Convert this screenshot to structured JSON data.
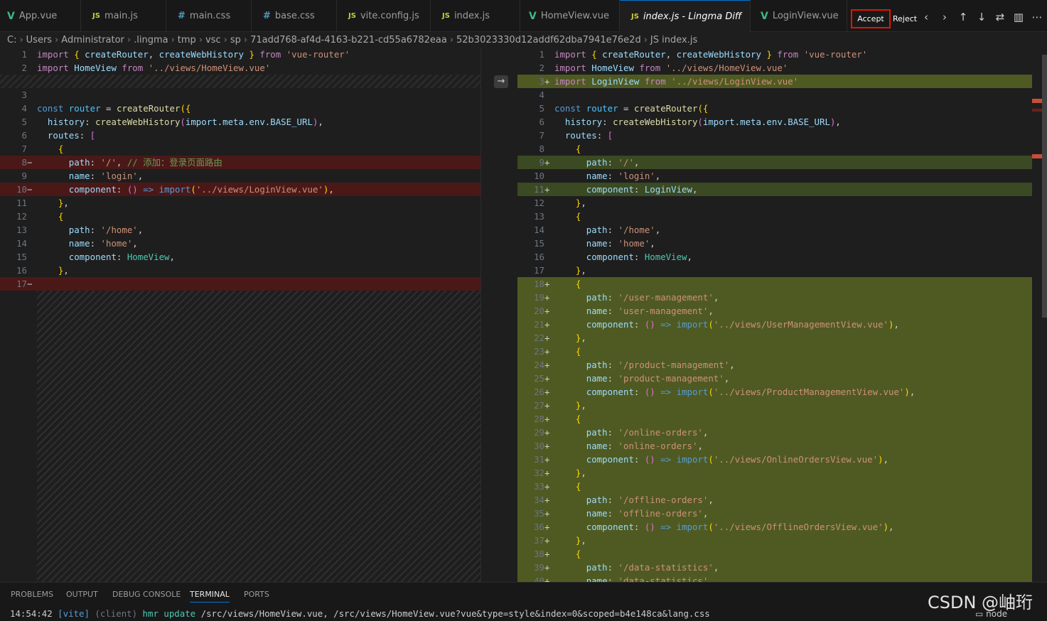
{
  "tabs": [
    {
      "label": "App.vue",
      "icon": "vue"
    },
    {
      "label": "main.js",
      "icon": "js"
    },
    {
      "label": "main.css",
      "icon": "css"
    },
    {
      "label": "base.css",
      "icon": "css"
    },
    {
      "label": "vite.config.js",
      "icon": "js"
    },
    {
      "label": "index.js",
      "icon": "js"
    },
    {
      "label": "HomeView.vue",
      "icon": "vue"
    },
    {
      "label": "index.js - Lingma Diff",
      "icon": "js",
      "active": true
    },
    {
      "label": "LoginView.vue",
      "icon": "vue"
    }
  ],
  "toolbar": {
    "accept": "Accept",
    "reject": "Reject"
  },
  "breadcrumb": [
    "C:",
    "Users",
    "Administrator",
    ".lingma",
    "tmp",
    "vsc",
    "sp",
    "71add768-af4d-4163-b221-cd55a6782eaa",
    "52b3023330d12addf62dba7941e76e2d",
    "index.js"
  ],
  "left_lines": [
    {
      "n": "1",
      "m": "",
      "t": "import_start"
    },
    {
      "n": "2",
      "m": "",
      "t": "import_home"
    },
    {
      "n": "",
      "m": "",
      "t": "hatch"
    },
    {
      "n": "3",
      "m": "",
      "t": "blank"
    },
    {
      "n": "4",
      "m": "",
      "t": "const_router"
    },
    {
      "n": "5",
      "m": "",
      "t": "history"
    },
    {
      "n": "6",
      "m": "",
      "t": "routes"
    },
    {
      "n": "7",
      "m": "",
      "t": "obj_open"
    },
    {
      "n": "8",
      "m": "−",
      "t": "path_root_comment",
      "cls": "del"
    },
    {
      "n": "9",
      "m": "",
      "t": "name_login"
    },
    {
      "n": "10",
      "m": "−",
      "t": "component_login_import",
      "cls": "del"
    },
    {
      "n": "11",
      "m": "",
      "t": "obj_close"
    },
    {
      "n": "12",
      "m": "",
      "t": "obj_open"
    },
    {
      "n": "13",
      "m": "",
      "t": "path_home"
    },
    {
      "n": "14",
      "m": "",
      "t": "name_home"
    },
    {
      "n": "15",
      "m": "",
      "t": "component_home"
    },
    {
      "n": "16",
      "m": "",
      "t": "obj_close"
    },
    {
      "n": "17",
      "m": "−",
      "t": "blank",
      "cls": "del"
    }
  ],
  "right_lines": [
    {
      "n": "1",
      "m": "",
      "t": "import_start"
    },
    {
      "n": "2",
      "m": "",
      "t": "import_home"
    },
    {
      "n": "3",
      "m": "+",
      "t": "import_login",
      "cls": "addfull"
    },
    {
      "n": "4",
      "m": "",
      "t": "blank"
    },
    {
      "n": "5",
      "m": "",
      "t": "const_router"
    },
    {
      "n": "6",
      "m": "",
      "t": "history"
    },
    {
      "n": "7",
      "m": "",
      "t": "routes"
    },
    {
      "n": "8",
      "m": "",
      "t": "obj_open"
    },
    {
      "n": "9",
      "m": "+",
      "t": "path_root",
      "cls": "add"
    },
    {
      "n": "10",
      "m": "",
      "t": "name_login"
    },
    {
      "n": "11",
      "m": "+",
      "t": "component_login",
      "cls": "add"
    },
    {
      "n": "12",
      "m": "",
      "t": "obj_close"
    },
    {
      "n": "13",
      "m": "",
      "t": "obj_open"
    },
    {
      "n": "14",
      "m": "",
      "t": "path_home"
    },
    {
      "n": "15",
      "m": "",
      "t": "name_home"
    },
    {
      "n": "16",
      "m": "",
      "t": "component_home"
    },
    {
      "n": "17",
      "m": "",
      "t": "obj_close"
    },
    {
      "n": "18",
      "m": "+",
      "t": "obj_open",
      "cls": "addfull"
    },
    {
      "n": "19",
      "m": "+",
      "t": "path:'/user-management'",
      "cls": "addfull"
    },
    {
      "n": "20",
      "m": "+",
      "t": "name:'user-management'",
      "cls": "addfull"
    },
    {
      "n": "21",
      "m": "+",
      "t": "comp:'../views/UserManagementView.vue'",
      "cls": "addfull"
    },
    {
      "n": "22",
      "m": "+",
      "t": "obj_close",
      "cls": "addfull"
    },
    {
      "n": "23",
      "m": "+",
      "t": "obj_open",
      "cls": "addfull"
    },
    {
      "n": "24",
      "m": "+",
      "t": "path:'/product-management'",
      "cls": "addfull"
    },
    {
      "n": "25",
      "m": "+",
      "t": "name:'product-management'",
      "cls": "addfull"
    },
    {
      "n": "26",
      "m": "+",
      "t": "comp:'../views/ProductManagementView.vue'",
      "cls": "addfull"
    },
    {
      "n": "27",
      "m": "+",
      "t": "obj_close",
      "cls": "addfull"
    },
    {
      "n": "28",
      "m": "+",
      "t": "obj_open",
      "cls": "addfull"
    },
    {
      "n": "29",
      "m": "+",
      "t": "path:'/online-orders'",
      "cls": "addfull"
    },
    {
      "n": "30",
      "m": "+",
      "t": "name:'online-orders'",
      "cls": "addfull"
    },
    {
      "n": "31",
      "m": "+",
      "t": "comp:'../views/OnlineOrdersView.vue'",
      "cls": "addfull"
    },
    {
      "n": "32",
      "m": "+",
      "t": "obj_close",
      "cls": "addfull"
    },
    {
      "n": "33",
      "m": "+",
      "t": "obj_open",
      "cls": "addfull"
    },
    {
      "n": "34",
      "m": "+",
      "t": "path:'/offline-orders'",
      "cls": "addfull"
    },
    {
      "n": "35",
      "m": "+",
      "t": "name:'offline-orders'",
      "cls": "addfull"
    },
    {
      "n": "36",
      "m": "+",
      "t": "comp:'../views/OfflineOrdersView.vue'",
      "cls": "addfull"
    },
    {
      "n": "37",
      "m": "+",
      "t": "obj_close",
      "cls": "addfull"
    },
    {
      "n": "38",
      "m": "+",
      "t": "obj_open",
      "cls": "addfull"
    },
    {
      "n": "39",
      "m": "+",
      "t": "path:'/data-statistics'",
      "cls": "addfull"
    },
    {
      "n": "40",
      "m": "+",
      "t": "name:'data-statistics'",
      "cls": "addfull"
    }
  ],
  "text": {
    "import": "import",
    "from": "from",
    "const": "const",
    "router": "router",
    "createRouter": "createRouter",
    "createWebHistory": "createWebHistory",
    "HomeView": "HomeView",
    "LoginView": "LoginView",
    "vue_router": "'vue-router'",
    "home_path": "'../views/HomeView.vue'",
    "login_path": "'../views/LoginView.vue'",
    "history": "history",
    "routes": "routes",
    "path": "path",
    "name": "name",
    "component": "component",
    "meta": "import.meta.env.BASE_URL",
    "root": "'/'",
    "login": "'login'",
    "home_route": "'/home'",
    "home": "'home'",
    "comment": "// 添加：登录页面路由"
  },
  "panel": {
    "tabs": [
      "PROBLEMS",
      "OUTPUT",
      "DEBUG CONSOLE",
      "TERMINAL",
      "PORTS"
    ],
    "active": "TERMINAL"
  },
  "terminal": {
    "time": "14:54:42",
    "tag": "[vite]",
    "client": "(client)",
    "hmr": "hmr update",
    "rest": "/src/views/HomeView.vue, /src/views/HomeView.vue?vue&type=style&index=0&scoped=b4e148ca&lang.css"
  },
  "node_label": "node",
  "watermark": "CSDN @岫珩"
}
